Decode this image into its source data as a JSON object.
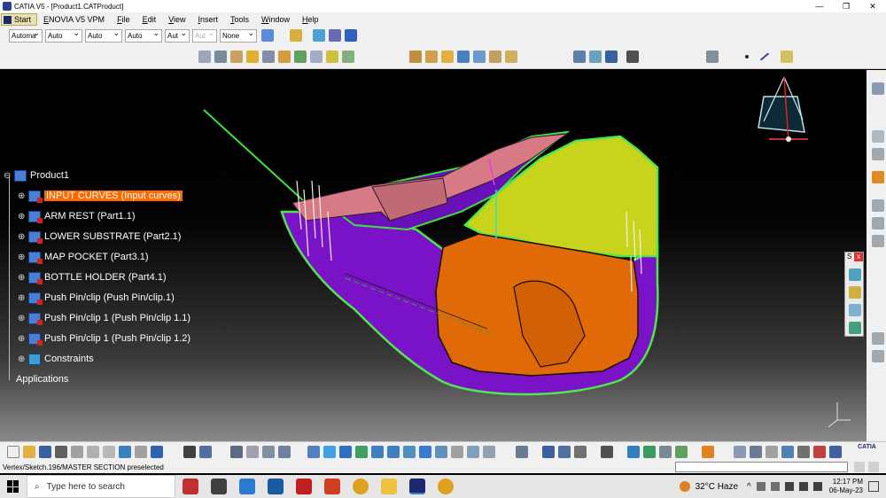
{
  "window": {
    "title": "CATIA V5 - [Product1.CATProduct]",
    "controls": [
      "—",
      "❐",
      "✕"
    ]
  },
  "menu": {
    "start": "Start",
    "items": [
      "ENOVIA V5 VPM",
      "File",
      "Edit",
      "View",
      "Insert",
      "Tools",
      "Window",
      "Help"
    ]
  },
  "toolbar1": {
    "combos": [
      "Automa",
      "Auto",
      "Auto",
      "Auto",
      "Aut",
      "Aut",
      "None"
    ]
  },
  "tree": {
    "root": "Product1",
    "children": [
      {
        "label": "INPUT CURVES (Input curves)",
        "selected": true
      },
      {
        "label": "ARM REST (Part1.1)"
      },
      {
        "label": "LOWER SUBSTRATE (Part2.1)"
      },
      {
        "label": "MAP POCKET (Part3.1)"
      },
      {
        "label": "BOTTLE HOLDER (Part4.1)"
      },
      {
        "label": "Push Pin/clip (Push Pin/clip.1)"
      },
      {
        "label": "Push Pin/clip 1 (Push Pin/clip 1.1)"
      },
      {
        "label": "Push Pin/clip 1 (Push Pin/clip 1.2)"
      },
      {
        "label": "Constraints"
      }
    ],
    "applications": "Applications"
  },
  "floating_panel": {
    "title": "S",
    "close": "x"
  },
  "status": {
    "message": "Vertex/Sketch.196/MASTER SECTION preselected"
  },
  "taskbar": {
    "search_placeholder": "Type here to search",
    "weather": "32°C  Haze",
    "time": "12:17 PM",
    "date": "06-May-23"
  },
  "logo": "CATIA",
  "axis": {
    "x": "x",
    "z": "z"
  }
}
